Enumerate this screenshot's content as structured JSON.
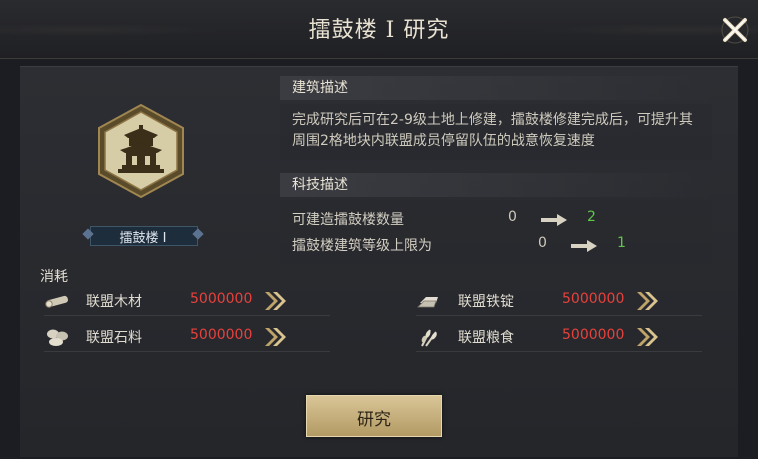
{
  "title": "擂鼓楼 I 研究",
  "building": {
    "name": "擂鼓楼 I",
    "icon": "drum-tower-icon"
  },
  "description": {
    "heading": "建筑描述",
    "text": "完成研究后可在2-9级土地上修建，擂鼓楼修建完成后，可提升其周围2格地块内联盟成员停留队伍的战意恢复速度"
  },
  "tech": {
    "heading": "科技描述",
    "rows": [
      {
        "label": "可建造擂鼓楼数量",
        "from": "0",
        "to": "2"
      },
      {
        "label": "擂鼓楼建筑等级上限为",
        "from": "0",
        "to": "1"
      }
    ]
  },
  "consume": {
    "label": "消耗",
    "items": [
      {
        "name": "联盟木材",
        "amount": "5000000",
        "icon": "wood-icon"
      },
      {
        "name": "联盟铁锭",
        "amount": "5000000",
        "icon": "iron-ingot-icon"
      },
      {
        "name": "联盟石料",
        "amount": "5000000",
        "icon": "stone-icon"
      },
      {
        "name": "联盟粮食",
        "amount": "5000000",
        "icon": "grain-icon"
      }
    ]
  },
  "research_button": "研究",
  "colors": {
    "insufficient": "#e8413c",
    "gain": "#62c64a",
    "button_gold": "#c9b27f"
  }
}
